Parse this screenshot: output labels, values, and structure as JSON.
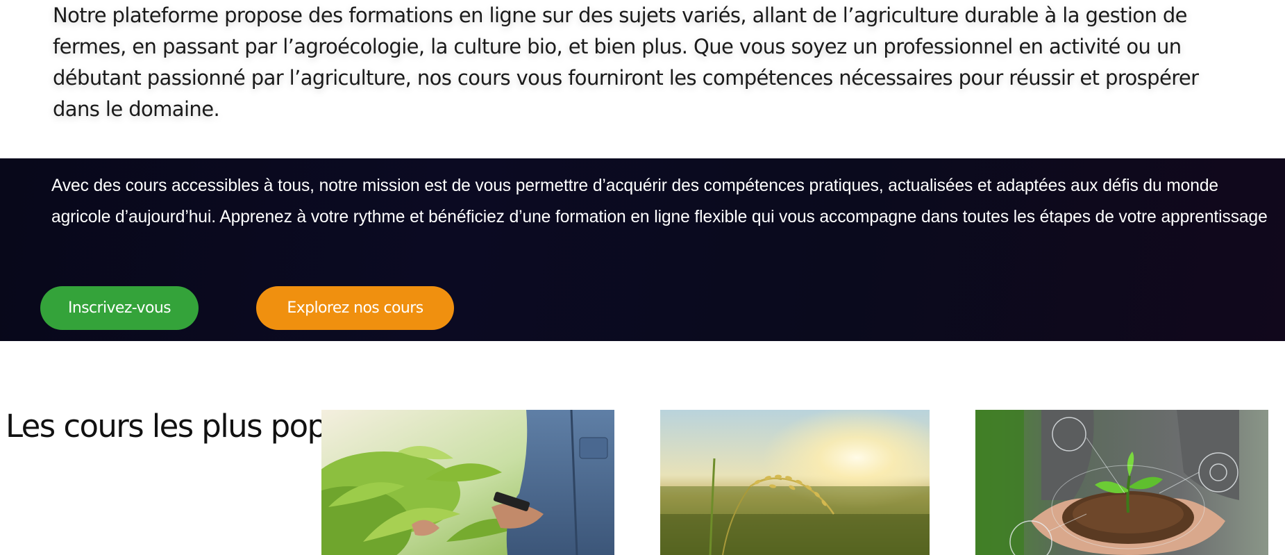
{
  "intro": {
    "text": "Notre plateforme propose des formations en ligne sur des sujets variés, allant de l’agriculture durable à la gestion de fermes, en passant par l’agroécologie, la culture bio, et bien plus. Que vous soyez un professionnel en activité ou un débutant passionné par l’agriculture, nos cours vous fourniront les compétences nécessaires pour réussir et prospérer dans le domaine."
  },
  "banner": {
    "text": "Avec des cours accessibles à tous, notre mission est de vous permettre d’acquérir des compétences pratiques, actualisées et adaptées aux défis du monde agricole d’aujourd’hui. Apprenez à votre rythme et bénéficiez d’une formation en ligne flexible qui vous accompagne dans toutes les étapes de votre apprentissage",
    "signup_label": "Inscrivez-vous",
    "explore_label": "Explorez nos cours",
    "colors": {
      "background": "#0a0a1e",
      "signup_button": "#34a33a",
      "explore_button": "#f0900f"
    }
  },
  "popular": {
    "title": "Les cours les plus populaires",
    "images": [
      {
        "alt": "farmer-with-phone-in-crop-field"
      },
      {
        "alt": "rice-ear-in-sunset-field"
      },
      {
        "alt": "hands-holding-seedling-in-soil"
      }
    ]
  }
}
